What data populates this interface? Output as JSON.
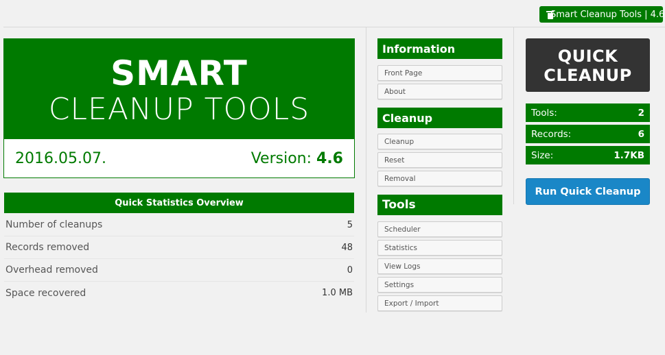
{
  "top_badge": {
    "label": "Smart Cleanup Tools | 4.6",
    "icon": "trash-icon"
  },
  "hero": {
    "line1": "SMART",
    "line2": "CLEANUP TOOLS",
    "date": "2016.05.07.",
    "version_label": "Version:",
    "version_number": "4.6"
  },
  "stats": {
    "title": "Quick Statistics Overview",
    "rows": [
      {
        "label": "Number of cleanups",
        "value": "5"
      },
      {
        "label": "Records removed",
        "value": "48"
      },
      {
        "label": "Overhead removed",
        "value": "0"
      },
      {
        "label": "Space recovered",
        "value": "1.0 MB"
      }
    ]
  },
  "menu": {
    "information": {
      "title": "Information",
      "items": [
        "Front Page",
        "About"
      ]
    },
    "cleanup": {
      "title": "Cleanup",
      "items": [
        "Cleanup",
        "Reset",
        "Removal"
      ]
    },
    "tools": {
      "title": "Tools",
      "items": [
        "Scheduler",
        "Statistics",
        "View Logs",
        "Settings",
        "Export / Import"
      ]
    }
  },
  "quick": {
    "big_line1": "QUICK",
    "big_line2": "CLEANUP",
    "summary": [
      {
        "label": "Tools:",
        "value": "2"
      },
      {
        "label": "Records:",
        "value": "6"
      },
      {
        "label": "Size:",
        "value": "1.7KB"
      }
    ],
    "run_label": "Run Quick Cleanup"
  },
  "colors": {
    "brand_green": "#007a00",
    "dark": "#333333",
    "button_blue": "#1a87c7"
  }
}
